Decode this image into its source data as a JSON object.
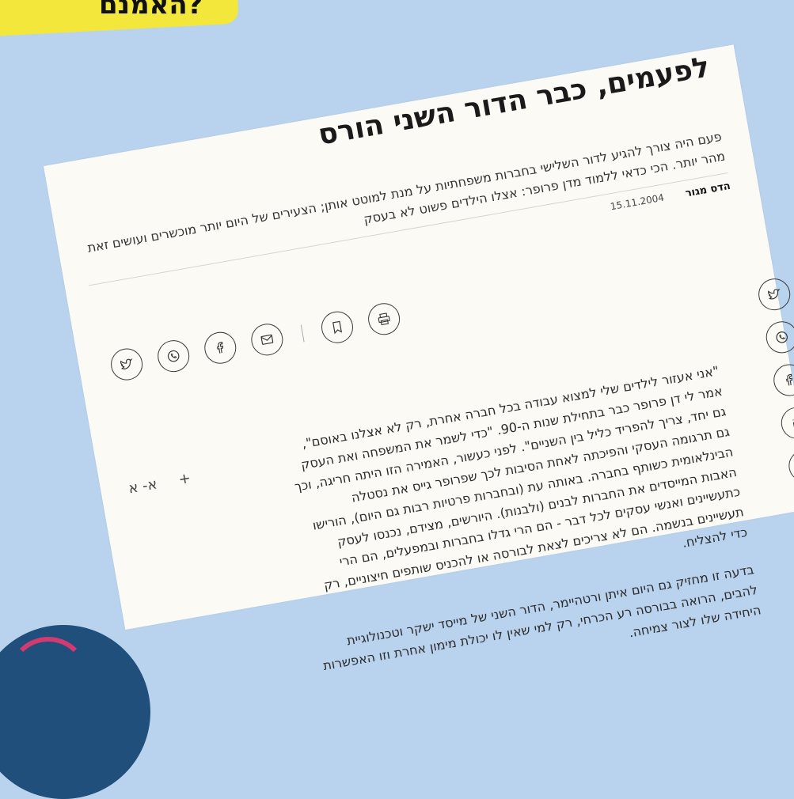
{
  "banner": {
    "text": "האמנם?"
  },
  "article": {
    "title": "לפעמים, כבר הדור השני הורס",
    "subtitle": "פעם היה צורך להגיע לדור השלישי בחברות משפחתיות על מנת למוטט אותן; הצעירים של היום יותר מוכשרים ועושים זאת מהר יותר. הכי כדאי ללמוד מדן פרופר: אצלו הילדים פשוט לא בעסק",
    "author": "הדס מגור",
    "date": "15.11.2004",
    "font_controls": {
      "increase": "א+",
      "decrease": "א-"
    },
    "paragraphs": [
      "\"אני אעזור לילדים שלי למצוא עבודה בכל חברה אחרת, רק לא אצלנו באוסם\", אמר לי דן פרופר כבר בתחילת שנות ה-90. \"כדי לשמר את המשפחה ואת העסק גם יחד, צריך להפריד כליל בין השניים\". לפני כעשור, האמירה הזו היתה חריגה, וכך גם תרגומה העסקי והפיכתה לאחת הסיבות לכך שפרופר גייס את נסטלה הבינלאומית כשותף בחברה. באותה עת (ובחברות פרטיות רבות גם היום), הורישו האבות המייסדים את החברות לבנים (ולבנות). היורשים, מצידם, נכנסו לעסק כתעשיינים ואנשי עסקים לכל דבר - הם הרי גדלו בחברות ובמפעלים, הם הרי תעשיינים בנשמה. הם לא צריכים לצאת לבורסה או להכניס שותפים חיצוניים, רק כדי להצליח.",
      "בדעה זו מחזיק גם היום איתן ורטהיימר, הדור השני של מייסד ישקר וטכנולוגיית להבים, הרואה בבורסה רע הכרחי, רק למי שאין לו יכולת מימון אחרת וזו האפשרות היחידה שלו לצור צמיחה."
    ]
  },
  "share_bar": {
    "icons": [
      "twitter-icon",
      "whatsapp-icon",
      "facebook-icon",
      "email-icon",
      "bookmark-icon",
      "print-icon"
    ]
  },
  "side_bar": {
    "icons": [
      "twitter-icon",
      "whatsapp-icon",
      "facebook-icon",
      "linkedin-icon",
      "email-icon",
      "bookmark-icon"
    ]
  },
  "colors": {
    "background": "#b9d3ee",
    "banner": "#f4e73b",
    "paper": "#fcfaf5"
  }
}
